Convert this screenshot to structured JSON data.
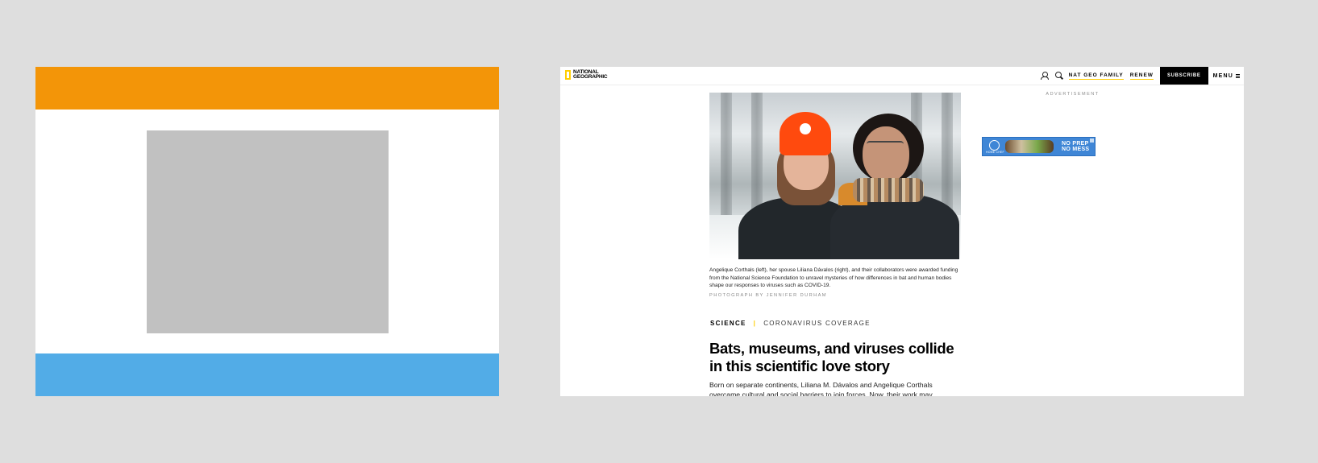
{
  "wireframe": {
    "colors": {
      "header": "#f39508",
      "content": "#c1c1c1",
      "footer": "#52ace7"
    }
  },
  "site": {
    "logo": {
      "line1": "NATIONAL",
      "line2": "GEOGRAPHIC",
      "accent_color": "#ffce00"
    },
    "nav": {
      "icons": [
        "user-icon",
        "search-icon"
      ],
      "links": [
        "NAT GEO FAMILY",
        "RENEW"
      ],
      "subscribe_label": "SUBSCRIBE",
      "menu_label": "MENU"
    },
    "article": {
      "caption": "Angelique Corthals (left), her spouse Liliana Dávalos (right), and their collaborators were awarded funding from the National Science Foundation to unravel mysteries of how differences in bat and human bodies shape our responses to viruses such as COVID-19.",
      "credit": "PHOTOGRAPH BY JENNIFER DURHAM",
      "kicker_section": "SCIENCE",
      "kicker_separator": "|",
      "kicker_topic": "CORONAVIRUS COVERAGE",
      "headline": "Bats, museums, and viruses collide in this scientific love story",
      "dek": "Born on separate continents, Liliana M. Dávalos and Angelique Corthals overcame cultural and social barriers to join forces. Now, their work may"
    },
    "sidebar": {
      "ad_label": "ADVERTISEMENT",
      "ad": {
        "brand": "HOME CHEF",
        "line1": "NO PREP",
        "line2": "NO MESS",
        "color": "#3f86d6"
      }
    }
  }
}
